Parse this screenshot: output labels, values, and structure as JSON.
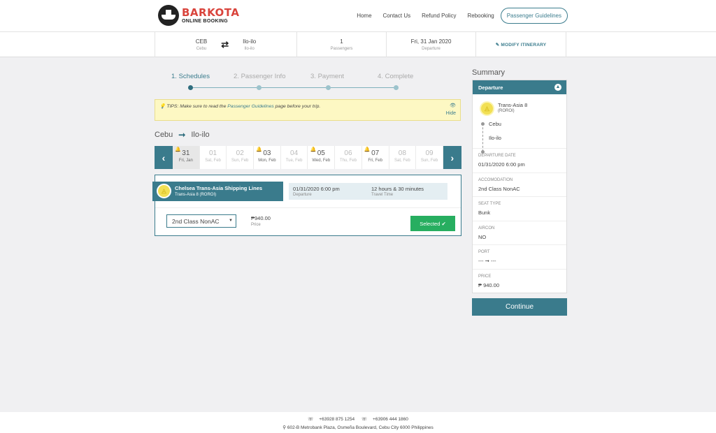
{
  "brand": {
    "name": "BARKOTA",
    "tagline": "ONLINE BOOKING"
  },
  "nav": [
    "Home",
    "Contact Us",
    "Refund Policy",
    "Rebooking"
  ],
  "nav_pill": "Passenger Guidelines",
  "itinerary": {
    "origin_code": "CEB",
    "origin_name": "Cebu",
    "dest_code": "Ilo-ilo",
    "dest_name": "Ilo-ilo",
    "passengers": "1",
    "passengers_label": "Passengers",
    "date": "Fri, 31 Jan 2020",
    "date_label": "Departure",
    "modify": "MODIFY ITINERARY"
  },
  "steps": [
    {
      "num": "1.",
      "label": "Schedules"
    },
    {
      "num": "2.",
      "label": "Passenger Info"
    },
    {
      "num": "3.",
      "label": "Payment"
    },
    {
      "num": "4.",
      "label": "Complete"
    }
  ],
  "tips": {
    "prefix": "TIPS:  Make sure to read the ",
    "link": "Passenger Guidelines",
    "suffix": " page before your trip.",
    "hide": "Hide"
  },
  "route": {
    "from": "Cebu",
    "to": "Ilo-ilo"
  },
  "dates": [
    {
      "num": "31",
      "day": "Fri, Jan",
      "bell": true,
      "state": "selected"
    },
    {
      "num": "01",
      "day": "Sat, Feb",
      "bell": false,
      "state": "disabled"
    },
    {
      "num": "02",
      "day": "Sun, Feb",
      "bell": false,
      "state": "disabled"
    },
    {
      "num": "03",
      "day": "Mon, Feb",
      "bell": true,
      "state": "normal"
    },
    {
      "num": "04",
      "day": "Tue, Feb",
      "bell": false,
      "state": "disabled"
    },
    {
      "num": "05",
      "day": "Wed, Feb",
      "bell": true,
      "state": "normal"
    },
    {
      "num": "06",
      "day": "Thu, Feb",
      "bell": false,
      "state": "disabled"
    },
    {
      "num": "07",
      "day": "Fri, Feb",
      "bell": true,
      "state": "normal"
    },
    {
      "num": "08",
      "day": "Sat, Feb",
      "bell": false,
      "state": "disabled"
    },
    {
      "num": "09",
      "day": "Sun, Feb",
      "bell": false,
      "state": "disabled"
    }
  ],
  "trip": {
    "line": "Chelsea Trans-Asia Shipping Lines",
    "vessel": "Trans-Asia 8 (ROROI)",
    "departure": "01/31/2020 6:00 pm",
    "departure_label": "Departure",
    "travel_time": "12 hours & 30 minutes",
    "travel_time_label": "Travel Time",
    "class": "2nd Class NonAC",
    "price": "₱940.00",
    "price_label": "Price",
    "selected_button": "Selected"
  },
  "summary": {
    "title": "Summary",
    "section": "Departure",
    "vessel": "Trans-Asia 8",
    "vessel_code": "(ROROI)",
    "from": "Cebu",
    "to": "Ilo-ilo",
    "rows": [
      {
        "label": "DEPARTURE DATE",
        "value": "01/31/2020 6:00 pm"
      },
      {
        "label": "ACCOMODATION",
        "value": "2nd Class NonAC"
      },
      {
        "label": "SEAT TYPE",
        "value": "Bunk"
      },
      {
        "label": "AIRCON",
        "value": "NO"
      },
      {
        "label": "PORT",
        "value": "--- ➞ ---"
      },
      {
        "label": "PRICE",
        "value": "₱ 940.00"
      }
    ],
    "continue": "Continue"
  },
  "footer": {
    "phone1": "+63928 875 1254",
    "phone2": "+63906 444 1860",
    "address": "602-B Metrobank Plaza, Osmeña Boulevard, Cebu City 6000 Philippines"
  }
}
